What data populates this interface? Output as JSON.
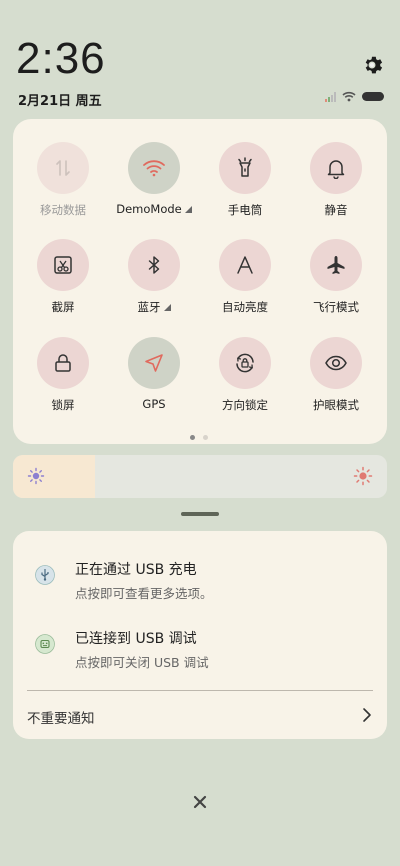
{
  "status": {
    "time": "2:36",
    "date": "2月21日 周五"
  },
  "quick_settings": {
    "tiles": [
      {
        "label": "移动数据",
        "icon": "mobile-data-icon",
        "state": "disabled"
      },
      {
        "label": "DemoMode",
        "icon": "wifi-icon",
        "state": "on"
      },
      {
        "label": "手电筒",
        "icon": "flashlight-icon",
        "state": "off"
      },
      {
        "label": "静音",
        "icon": "bell-icon",
        "state": "off"
      },
      {
        "label": "截屏",
        "icon": "screenshot-icon",
        "state": "off"
      },
      {
        "label": "蓝牙",
        "icon": "bluetooth-icon",
        "state": "off"
      },
      {
        "label": "自动亮度",
        "icon": "auto-brightness-icon",
        "state": "off"
      },
      {
        "label": "飞行模式",
        "icon": "airplane-icon",
        "state": "off"
      },
      {
        "label": "锁屏",
        "icon": "lock-icon",
        "state": "off"
      },
      {
        "label": "GPS",
        "icon": "location-arrow-icon",
        "state": "on"
      },
      {
        "label": "方向锁定",
        "icon": "rotation-lock-icon",
        "state": "off"
      },
      {
        "label": "护眼模式",
        "icon": "eye-icon",
        "state": "off"
      }
    ],
    "page_count": 2,
    "active_page": 1
  },
  "brightness": {
    "level_fraction": 0.22
  },
  "notifications": {
    "items": [
      {
        "title": "正在通过 USB 充电",
        "text": "点按即可查看更多选项。",
        "icon": "usb-icon"
      },
      {
        "title": "已连接到 USB 调试",
        "text": "点按即可关闭 USB 调试",
        "icon": "android-debug-icon"
      }
    ],
    "unimportant_label": "不重要通知"
  },
  "colors": {
    "background": "#d6ddcf",
    "card": "#f8f3e8",
    "tile_off": "#ecd6d3",
    "tile_on": "#cfd3c7",
    "wifi_accent": "#e06a5e"
  }
}
